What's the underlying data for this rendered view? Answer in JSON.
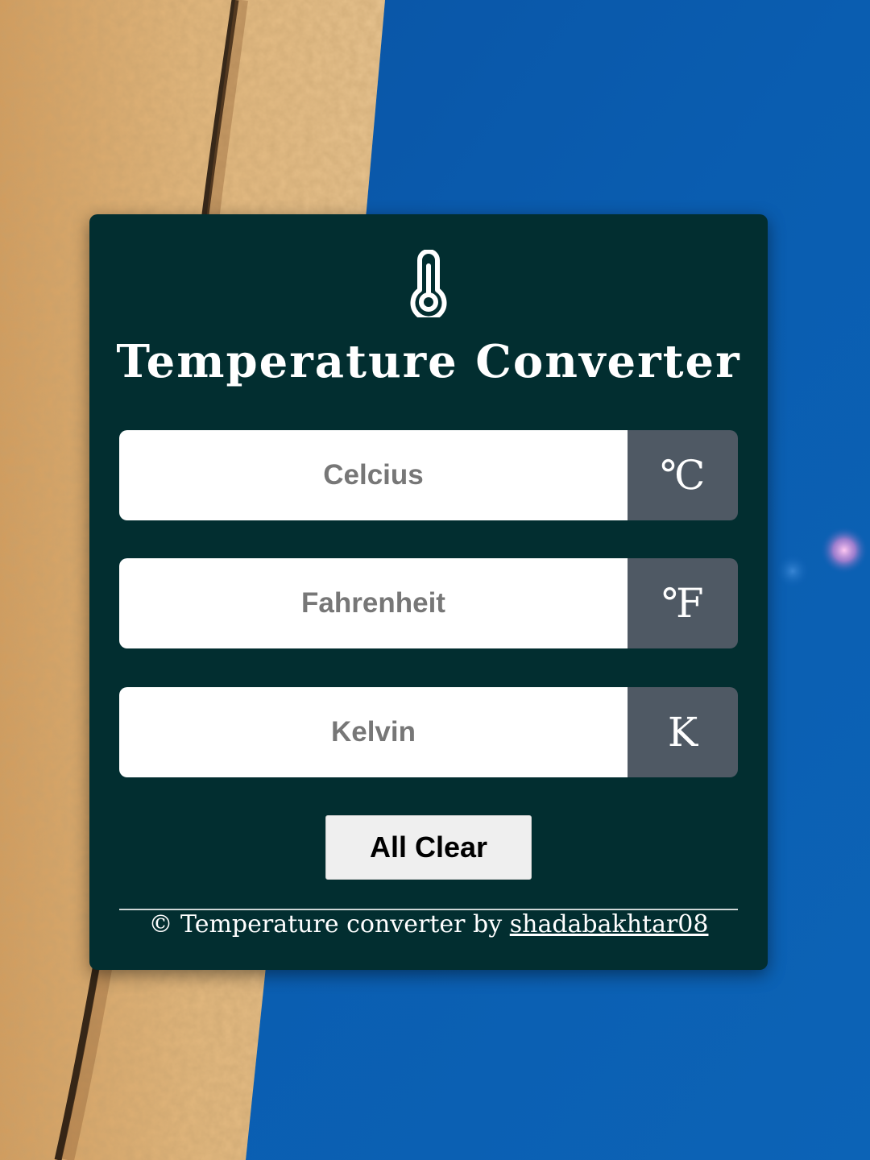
{
  "app": {
    "title": "Temperature Converter",
    "icon": "thermometer-icon"
  },
  "fields": [
    {
      "name": "celsius",
      "placeholder": "Celcius",
      "value": "",
      "unit": "℃"
    },
    {
      "name": "fahrenheit",
      "placeholder": "Fahrenheit",
      "value": "",
      "unit": "℉"
    },
    {
      "name": "kelvin",
      "placeholder": "Kelvin",
      "value": "",
      "unit": "K"
    }
  ],
  "actions": {
    "clear_label": "All Clear"
  },
  "footer": {
    "text": "© Temperature converter by ",
    "author": "shadabakhtar08"
  },
  "colors": {
    "card_background": "#022e30",
    "unit_background": "#4f5964",
    "sea": "#0b5aa8",
    "sand": "#dcae72"
  }
}
